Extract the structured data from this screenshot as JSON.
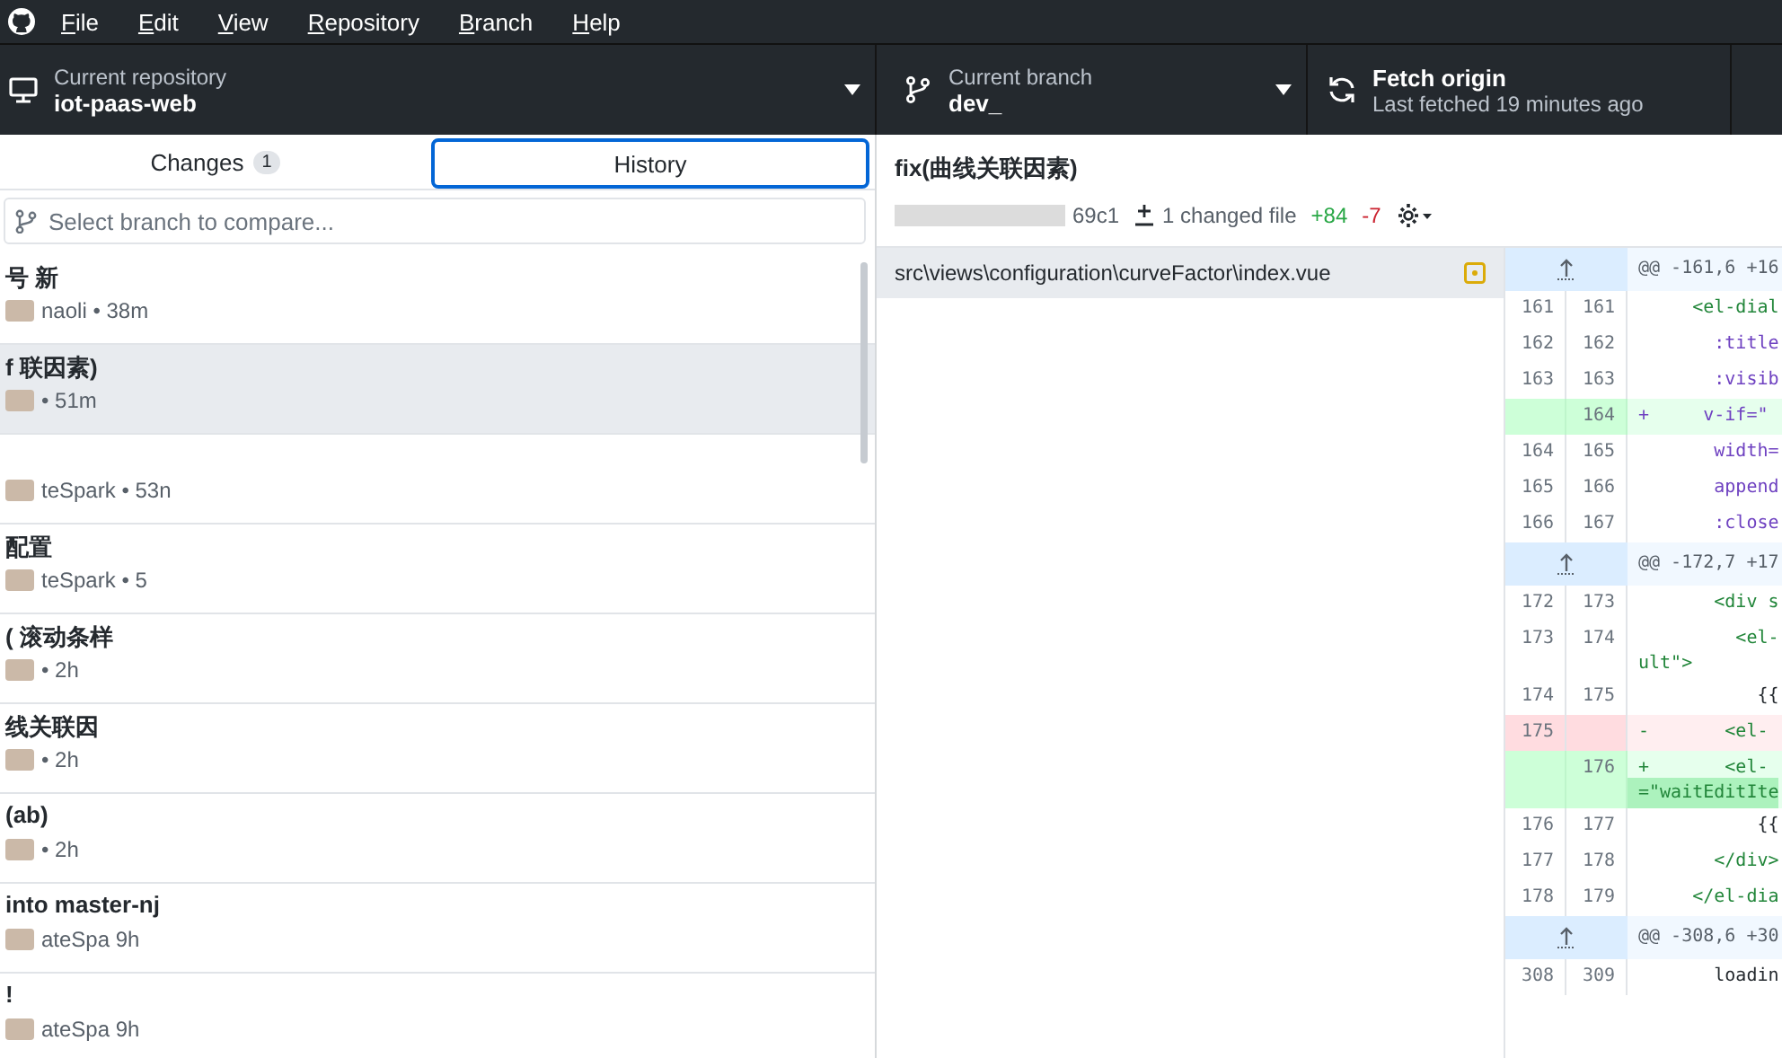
{
  "menu_bar": {
    "items": [
      "File",
      "Edit",
      "View",
      "Repository",
      "Branch",
      "Help"
    ]
  },
  "toolbar": {
    "repository": {
      "label": "Current repository",
      "name": "iot-paas-web"
    },
    "branch": {
      "label": "Current branch",
      "name": "dev_"
    },
    "fetch": {
      "title": "Fetch origin",
      "subtitle": "Last fetched 19 minutes ago"
    }
  },
  "tabs": [
    {
      "label": "Changes",
      "count": "1",
      "selected": false
    },
    {
      "label": "History",
      "selected": true
    }
  ],
  "branch_filter": {
    "placeholder": "Select branch to compare..."
  },
  "commits": [
    {
      "title": "号 新",
      "meta": "naoli • 38m",
      "selected": false
    },
    {
      "title": "f 联因素)",
      "meta": "• 51m",
      "selected": true
    },
    {
      "meta": "teSpark • 53n",
      "selected": false
    },
    {
      "title": "配置",
      "meta": "teSpark • 5",
      "selected": false
    },
    {
      "title": "( 滚动条样",
      "meta": "• 2h",
      "selected": false
    },
    {
      "title": "线关联因",
      "meta": "• 2h",
      "selected": false
    },
    {
      "title": "(ab)",
      "meta": "• 2h",
      "selected": false
    },
    {
      "title": "into master-nj",
      "meta": "ateSpa 9h",
      "selected": false
    },
    {
      "title": "!",
      "meta": "ateSpa 9h",
      "selected": false
    }
  ],
  "commit": {
    "title": "fix(曲线关联因素)",
    "sha": "69c1",
    "changed_files": "1 changed file",
    "additions": "+84",
    "deletions": "-7"
  },
  "files": [
    {
      "path": "src\\views\\configuration\\curveFactor\\index.vue",
      "selected": true
    }
  ],
  "diff": [
    {
      "kind": "hunk",
      "text": "@@ -161,6 +16"
    },
    {
      "kind": "context",
      "old": "161",
      "new": "161",
      "code": "    <el-dial",
      "color": "#22863a"
    },
    {
      "kind": "context",
      "old": "162",
      "new": "162",
      "code": "      :title",
      "color": "#6f42c1"
    },
    {
      "kind": "context",
      "old": "163",
      "new": "163",
      "code": "      :visib",
      "color": "#6f42c1"
    },
    {
      "kind": "add",
      "new": "164",
      "sign": "+",
      "code": "     v-if=\"",
      "color": "#6f42c1"
    },
    {
      "kind": "context",
      "old": "164",
      "new": "165",
      "code": "      width=",
      "color": "#6f42c1"
    },
    {
      "kind": "context",
      "old": "165",
      "new": "166",
      "code": "      append",
      "color": "#6f42c1"
    },
    {
      "kind": "context",
      "old": "166",
      "new": "167",
      "code": "      :close",
      "color": "#6f42c1"
    },
    {
      "kind": "hunk",
      "text": "@@ -172,7 +17"
    },
    {
      "kind": "context",
      "old": "172",
      "new": "173",
      "code": "      <div s",
      "color": "#22863a"
    },
    {
      "kind": "context",
      "old": "173",
      "new": "174",
      "code": "        <el-",
      "color": "#22863a",
      "wrap": "ult\">"
    },
    {
      "kind": "context",
      "old": "174",
      "new": "175",
      "code": "          {{",
      "color": "#24292e"
    },
    {
      "kind": "del",
      "old": "175",
      "sign": "-",
      "code": "       <el-",
      "color": "#22863a"
    },
    {
      "kind": "add",
      "new": "176",
      "sign": "+",
      "code": "       <el-",
      "color": "#22863a",
      "wrap": "=\"waitEditIte",
      "wrap_highlighted": true
    },
    {
      "kind": "context",
      "old": "176",
      "new": "177",
      "code": "          {{",
      "color": "#24292e"
    },
    {
      "kind": "context",
      "old": "177",
      "new": "178",
      "code": "      </div>",
      "color": "#22863a"
    },
    {
      "kind": "context",
      "old": "178",
      "new": "179",
      "code": "    </el-dia",
      "color": "#22863a"
    },
    {
      "kind": "hunk",
      "text": "@@ -308,6 +30"
    },
    {
      "kind": "context",
      "old": "308",
      "new": "309",
      "code": "      loadin",
      "color": "#24292e"
    }
  ]
}
